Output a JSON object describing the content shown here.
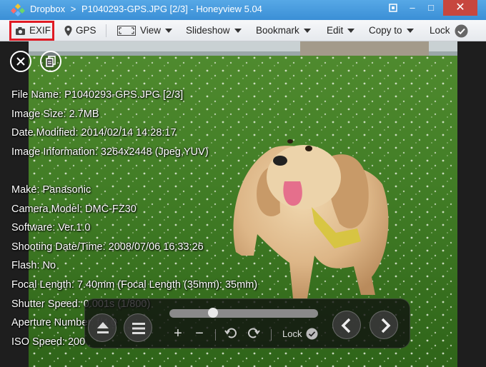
{
  "window": {
    "breadcrumb_root": "Dropbox",
    "breadcrumb_sep": ">",
    "title": "P1040293-GPS.JPG [2/3] - Honeyview 5.04",
    "fit_icon": "fit-screen-icon",
    "minimize_glyph": "–",
    "maximize_glyph": "□",
    "close_glyph": "✕"
  },
  "toolbar": {
    "exif_label": "EXIF",
    "gps_label": "GPS",
    "view_label": "View",
    "slideshow_label": "Slideshow",
    "bookmark_label": "Bookmark",
    "edit_label": "Edit",
    "copyto_label": "Copy to",
    "lock_label": "Lock"
  },
  "exif": {
    "file_name": "File Name: P1040293-GPS.JPG [2/3]",
    "image_size": "Image Size: 2.7MB",
    "date_modified": "Date Modified: 2014/02/14 14:28:17",
    "image_info": "Image Information: 3264x2448 (Jpeg,YUV)",
    "make": "Make: Panasonic",
    "camera_model": "Camera Model: DMC-FZ30",
    "software": "Software: Ver.1.0",
    "shooting_date": "Shooting Date/Time: 2008/07/06 16:33:26",
    "flash": "Flash: No",
    "focal_length": "Focal Length: 7.40mm (Focal Length (35mm): 35mm)",
    "shutter_speed": "Shutter Speed: 0.001s (1/800)",
    "aperture": "Aperture Number: f/4.0",
    "iso": "ISO Speed: 200"
  },
  "controls": {
    "lock_label": "Lock",
    "slider_position": 0.28,
    "zoom_in_glyph": "+",
    "zoom_out_glyph": "−"
  },
  "colors": {
    "titlebar": "#3b8fd6",
    "close_red": "#c7473f",
    "highlight_red": "#e01b24"
  }
}
